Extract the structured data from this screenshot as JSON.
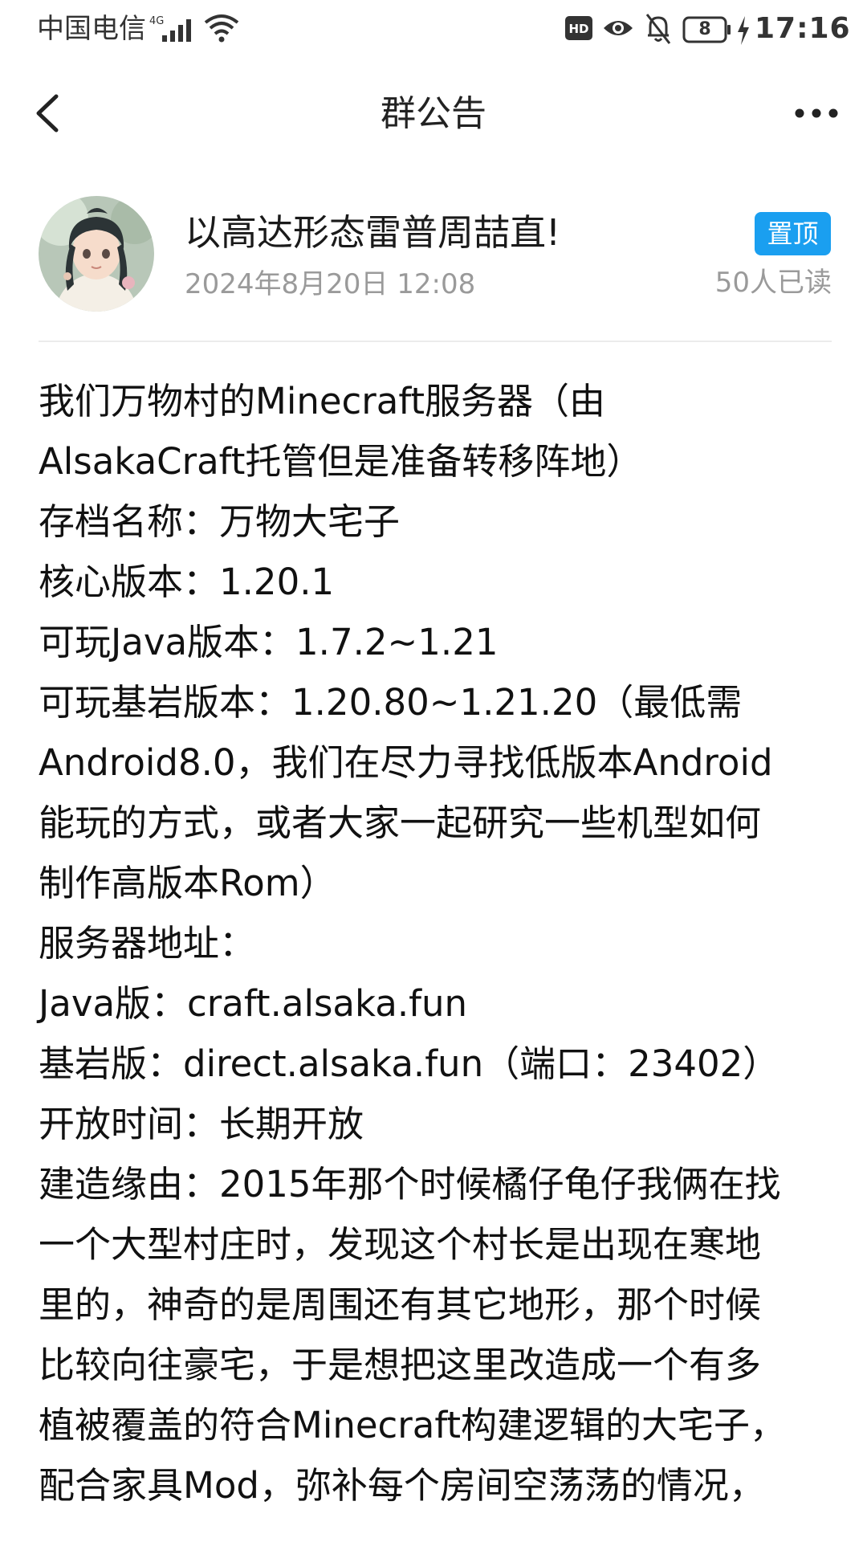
{
  "status_bar": {
    "carrier": "中国电信",
    "network": "4G",
    "battery_level": "8",
    "time": "17:16"
  },
  "nav": {
    "title": "群公告",
    "back_icon": "chevron-left-icon",
    "more_icon": "more-horizontal-icon"
  },
  "post": {
    "author": "以高达形态雷普周喆直!",
    "date": "2024年8月20日 12:08",
    "badge": "置顶",
    "read_count": "50人已读",
    "accent_color": "#1a9ff0",
    "lines": [
      "我们万物村的Minecraft服务器（由",
      "AlsakaCraft托管但是准备转移阵地）",
      "存档名称：万物大宅子",
      "核心版本：1.20.1",
      "可玩Java版本：1.7.2~1.21",
      "可玩基岩版本：1.20.80~1.21.20（最低需",
      "Android8.0，我们在尽力寻找低版本Android",
      "能玩的方式，或者大家一起研究一些机型如何",
      "制作高版本Rom）",
      "服务器地址：",
      "Java版：craft.alsaka.fun",
      "基岩版：direct.alsaka.fun（端口：23402）",
      "开放时间：长期开放",
      "建造缘由：2015年那个时候橘仔龟仔我俩在找",
      "一个大型村庄时，发现这个村长是出现在寒地",
      "里的，神奇的是周围还有其它地形，那个时候",
      "比较向往豪宅，于是想把这里改造成一个有多",
      "植被覆盖的符合Minecraft构建逻辑的大宅子，",
      "配合家具Mod，弥补每个房间空荡荡的情况，"
    ]
  }
}
